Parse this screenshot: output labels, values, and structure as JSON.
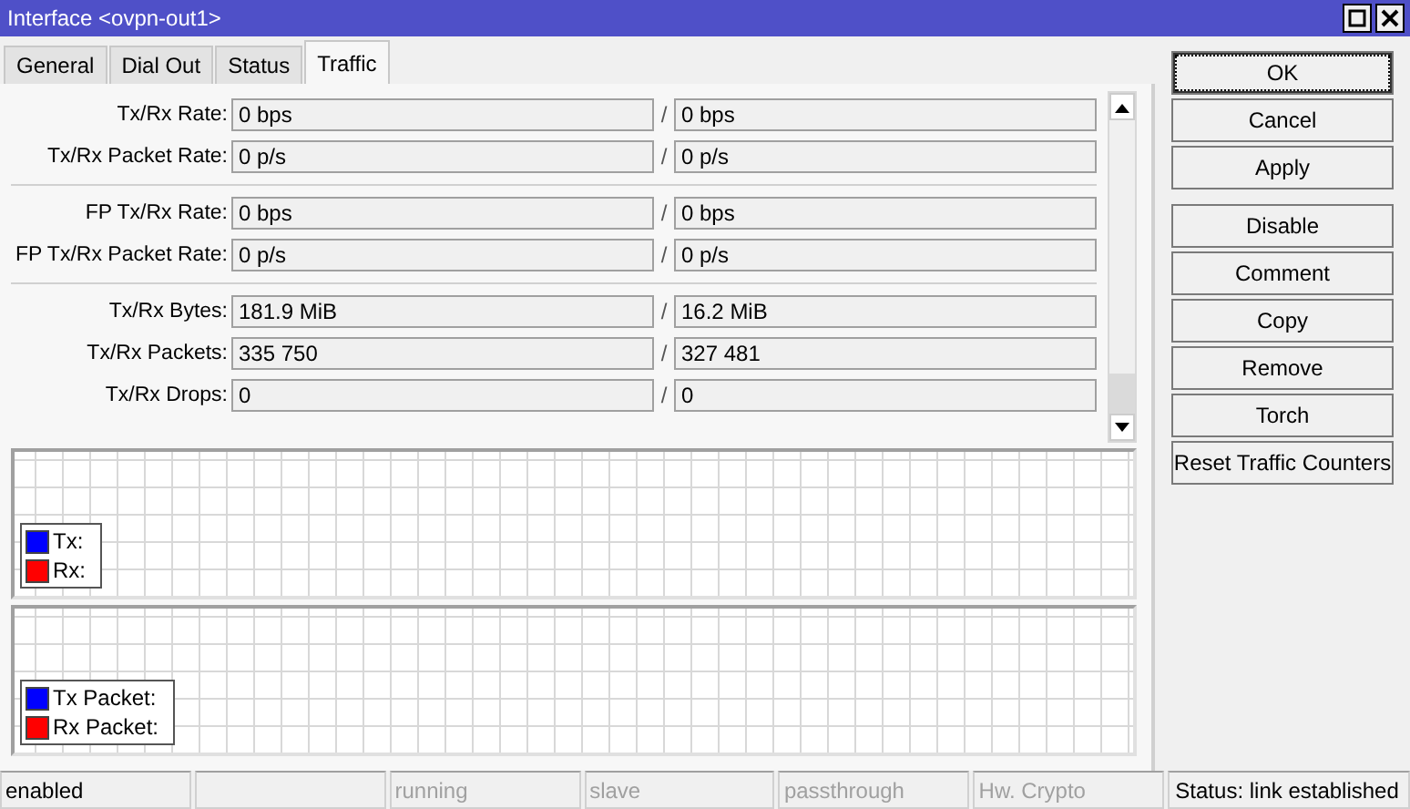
{
  "window": {
    "title": "Interface <ovpn-out1>"
  },
  "tabs": [
    {
      "label": "General",
      "selected": false
    },
    {
      "label": "Dial Out",
      "selected": false
    },
    {
      "label": "Status",
      "selected": false
    },
    {
      "label": "Traffic",
      "selected": true
    }
  ],
  "field_groups": [
    [
      {
        "label": "Tx/Rx Rate:",
        "tx": "0 bps",
        "separator": "/",
        "rx": "0 bps"
      },
      {
        "label": "Tx/Rx Packet Rate:",
        "tx": "0 p/s",
        "separator": "/",
        "rx": "0 p/s"
      }
    ],
    [
      {
        "label": "FP Tx/Rx Rate:",
        "tx": "0 bps",
        "separator": "/",
        "rx": "0 bps"
      },
      {
        "label": "FP Tx/Rx Packet Rate:",
        "tx": "0 p/s",
        "separator": "/",
        "rx": "0 p/s"
      }
    ],
    [
      {
        "label": "Tx/Rx Bytes:",
        "tx": "181.9 MiB",
        "separator": "/",
        "rx": "16.2 MiB"
      },
      {
        "label": "Tx/Rx Packets:",
        "tx": "335 750",
        "separator": "/",
        "rx": "327 481"
      },
      {
        "label": "Tx/Rx Drops:",
        "tx": "0",
        "separator": "/",
        "rx": "0"
      }
    ]
  ],
  "graphs": [
    {
      "legend": [
        {
          "label": "Tx:",
          "color": "#0000ff"
        },
        {
          "label": "Rx:",
          "color": "#ff0000"
        }
      ]
    },
    {
      "legend": [
        {
          "label": "Tx Packet:",
          "color": "#0000ff"
        },
        {
          "label": "Rx Packet:",
          "color": "#ff0000"
        }
      ]
    }
  ],
  "button_groups": [
    [
      {
        "label": "OK",
        "focused": true
      },
      {
        "label": "Cancel",
        "focused": false
      },
      {
        "label": "Apply",
        "focused": false
      }
    ],
    [
      {
        "label": "Disable",
        "focused": false
      },
      {
        "label": "Comment",
        "focused": false
      },
      {
        "label": "Copy",
        "focused": false
      },
      {
        "label": "Remove",
        "focused": false
      },
      {
        "label": "Torch",
        "focused": false
      },
      {
        "label": "Reset Traffic Counters",
        "focused": false
      }
    ]
  ],
  "status_bar": {
    "cells": [
      {
        "label": "enabled",
        "disabled": false
      },
      {},
      {
        "label": "running",
        "disabled": true
      },
      {
        "label": "slave",
        "disabled": true
      },
      {
        "label": "passthrough",
        "disabled": true
      },
      {
        "label": "Hw. Crypto",
        "disabled": true
      }
    ],
    "status": "Status: link established"
  }
}
